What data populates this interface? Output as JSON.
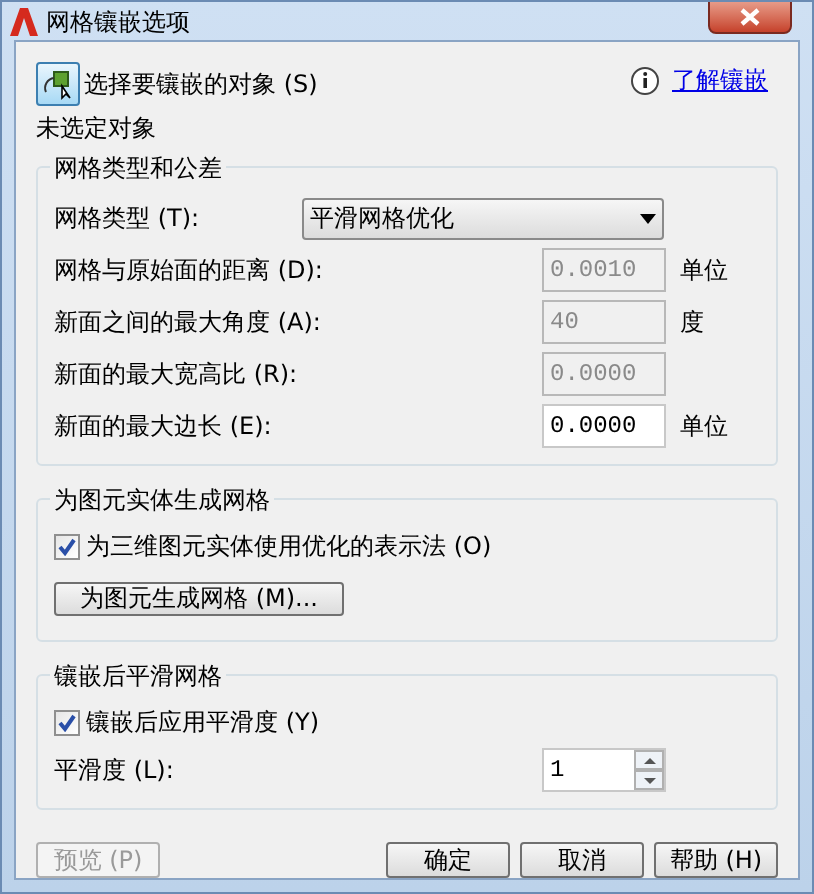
{
  "window": {
    "title": "网格镶嵌选项"
  },
  "select_objects": {
    "label": "选择要镶嵌的对象 (S)",
    "status": "未选定对象"
  },
  "help_link": {
    "label": "了解镶嵌"
  },
  "groups": [
    {
      "title": "网格类型和公差",
      "items": [
        {
          "kind": "dropdown",
          "label": "网格类型 (T):",
          "value": "平滑网格优化"
        },
        {
          "kind": "field",
          "label": "网格与原始面的距离 (D):",
          "value": "0.0010",
          "unit": "单位",
          "disabled": true
        },
        {
          "kind": "field",
          "label": "新面之间的最大角度 (A):",
          "value": "40",
          "unit": "度",
          "disabled": true
        },
        {
          "kind": "field",
          "label": "新面的最大宽高比 (R):",
          "value": "0.0000",
          "disabled": true
        },
        {
          "kind": "field",
          "label": "新面的最大边长 (E):",
          "value": "0.0000",
          "unit": "单位",
          "disabled": false
        }
      ]
    },
    {
      "title": "为图元实体生成网格",
      "items": [
        {
          "kind": "checkbox",
          "label": "为三维图元实体使用优化的表示法 (O)",
          "checked": true
        },
        {
          "kind": "button",
          "label": "为图元生成网格 (M)..."
        }
      ]
    },
    {
      "title": "镶嵌后平滑网格",
      "items": [
        {
          "kind": "checkbox",
          "label": "镶嵌后应用平滑度 (Y)",
          "checked": true
        },
        {
          "kind": "spinner",
          "label": "平滑度 (L):",
          "value": "1"
        }
      ]
    }
  ],
  "buttons": [
    {
      "label": "预览 (P)",
      "disabled": true
    },
    {
      "label": "确定",
      "disabled": false
    },
    {
      "label": "取消",
      "disabled": false
    },
    {
      "label": "帮助 (H)",
      "disabled": false
    }
  ]
}
